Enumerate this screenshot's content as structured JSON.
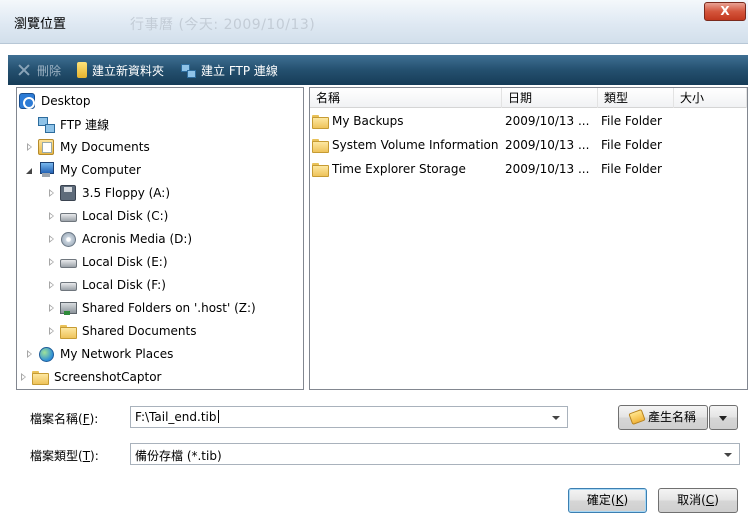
{
  "window": {
    "title": "瀏覽位置",
    "ghost_title": "行事曆 (今天: 2009/10/13)",
    "close_label": "X"
  },
  "toolbar": {
    "delete_label": "刪除",
    "new_folder_label": "建立新資料夾",
    "new_ftp_label": "建立 FTP 連線"
  },
  "tree": {
    "items": [
      {
        "label": "Desktop",
        "icon": "desktop-icon",
        "level": 0,
        "state": "none"
      },
      {
        "label": "FTP 連線",
        "icon": "ftp-icon",
        "level": 1,
        "state": "none"
      },
      {
        "label": "My Documents",
        "icon": "documents-icon",
        "level": 1,
        "state": "collapsed"
      },
      {
        "label": "My Computer",
        "icon": "computer-icon",
        "level": 1,
        "state": "expanded"
      },
      {
        "label": "3.5 Floppy (A:)",
        "icon": "floppy-icon",
        "level": 2,
        "state": "collapsed"
      },
      {
        "label": "Local Disk (C:)",
        "icon": "disk-icon",
        "level": 2,
        "state": "collapsed"
      },
      {
        "label": "Acronis Media (D:)",
        "icon": "cd-icon",
        "level": 2,
        "state": "collapsed"
      },
      {
        "label": "Local Disk (E:)",
        "icon": "disk-icon",
        "level": 2,
        "state": "collapsed"
      },
      {
        "label": "Local Disk (F:)",
        "icon": "disk-icon",
        "level": 2,
        "state": "collapsed"
      },
      {
        "label": "Shared Folders on '.host' (Z:)",
        "icon": "network-drive-icon",
        "level": 2,
        "state": "collapsed"
      },
      {
        "label": "Shared Documents",
        "icon": "folder-icon",
        "level": 2,
        "state": "collapsed"
      },
      {
        "label": "My Network Places",
        "icon": "network-icon",
        "level": 1,
        "state": "collapsed"
      },
      {
        "label": "ScreenshotCaptor",
        "icon": "folder-icon",
        "level": 0,
        "state": "collapsed"
      }
    ]
  },
  "list": {
    "columns": [
      "名稱",
      "日期",
      "類型",
      "大小"
    ],
    "rows": [
      {
        "name": "My Backups",
        "date": "2009/10/13 ...",
        "type": "File Folder",
        "size": ""
      },
      {
        "name": "System Volume Information",
        "date": "2009/10/13 ...",
        "type": "File Folder",
        "size": ""
      },
      {
        "name": "Time Explorer Storage",
        "date": "2009/10/13 ...",
        "type": "File Folder",
        "size": ""
      }
    ]
  },
  "form": {
    "filename_label": "檔案名稱(",
    "filename_key": "F",
    "filename_label_end": "):",
    "filename_value": "F:\\Tail_end.tib",
    "filetype_label": "檔案類型(",
    "filetype_key": "T",
    "filetype_label_end": "):",
    "filetype_value": "備份存檔 (*.tib)",
    "generate_label": "產生名稱"
  },
  "buttons": {
    "ok_label": "確定(",
    "ok_key": "K",
    "ok_end": ")",
    "cancel_label": "取消(",
    "cancel_key": "C",
    "cancel_end": ")"
  }
}
